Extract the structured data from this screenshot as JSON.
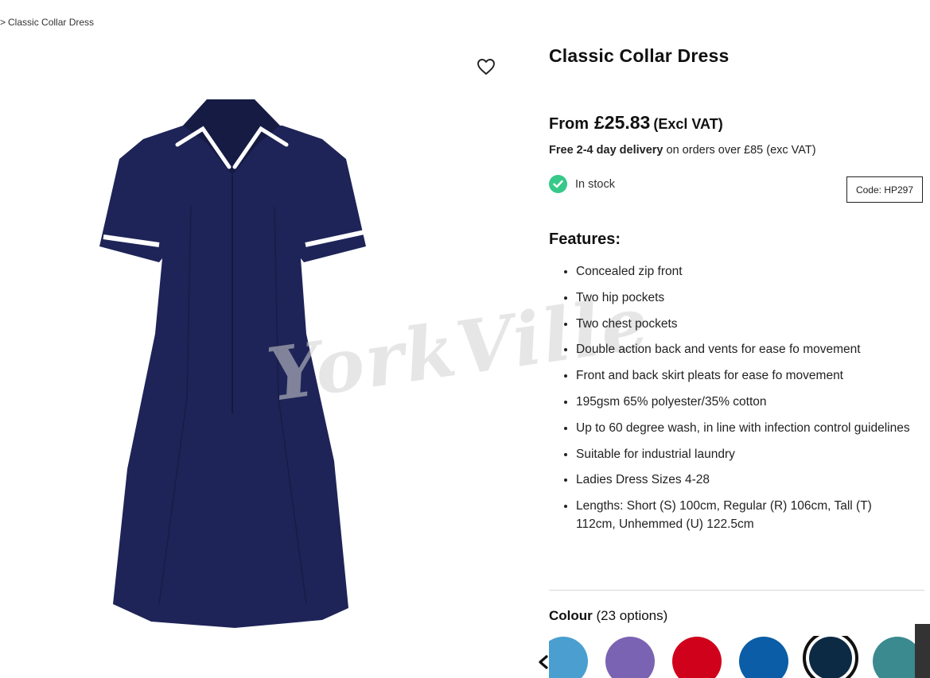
{
  "breadcrumb": {
    "separator": ">",
    "current": "Classic Collar Dress"
  },
  "gallery": {
    "wishlist_icon": "heart-outline-icon",
    "watermark": "YorkVille",
    "dress_colour": "#1e2457",
    "trim_colour": "#ffffff"
  },
  "product": {
    "title": "Classic Collar Dress",
    "price_prefix": "From",
    "price": "£25.83",
    "vat_note": "(Excl VAT)",
    "delivery_bold": "Free 2-4 day delivery",
    "delivery_rest": " on orders over £85 (exc VAT)",
    "stock_status": "In stock",
    "stock_icon": "check-circle-icon",
    "code": "Code: HP297"
  },
  "features": {
    "heading": "Features:",
    "items": [
      "Concealed zip front",
      "Two hip pockets",
      "Two chest pockets",
      "Double action back and vents for ease fo movement",
      "Front and back skirt pleats for ease fo movement",
      "195gsm 65% polyester/35% cotton",
      "Up to 60 degree wash, in line with infection control guidelines",
      "Suitable for industrial laundry",
      "Ladies Dress Sizes 4-28",
      "Lengths: Short (S) 100cm, Regular (R) 106cm, Tall (T) 112cm, Unhemmed (U) 122.5cm"
    ]
  },
  "colour": {
    "label": "Colour",
    "count_text": "(23 options)",
    "prev_icon": "chevron-left-icon",
    "swatches": [
      "#4a9fd0",
      "#7b63b3",
      "#d0021b",
      "#0a5da6",
      "#0d2a45",
      "#3a8a8f"
    ],
    "selected_index": 4
  }
}
